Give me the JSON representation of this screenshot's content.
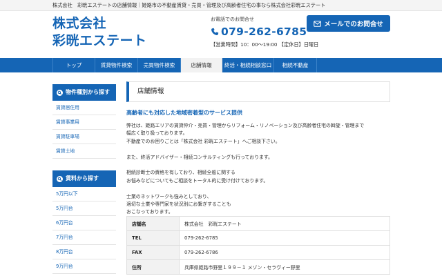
{
  "topbar": {
    "text": "株式会社　彩晄エステートの店舗情報｜姫路市の不動産賃貸・売買・管理及び高齢者住宅の事なら株式会社彩晄エステート"
  },
  "logo": {
    "line1": "株式会社",
    "line2": "彩晄エステート"
  },
  "contact": {
    "caption": "お電話でのお問合せ",
    "phone": "079-262-6785",
    "hours": "【営業時間】10：00〜19:00 【定休日】日曜日",
    "mail_button": "メールでのお問合せ"
  },
  "nav": [
    "トップ",
    "賃貸物件検索",
    "売買物件検索",
    "店舗情報",
    "終活・相続相談窓口",
    "相続不動産"
  ],
  "sidebar": {
    "types_heading": "物件種別から探す",
    "types": [
      "賃貸居住用",
      "賃貸事業用",
      "賃貸駐車場",
      "賃貸土地"
    ],
    "rent_heading": "賃料から探す",
    "rents": [
      "5万円以下",
      "5万円台",
      "6万円台",
      "7万円台",
      "8万円台",
      "9万円台"
    ]
  },
  "main": {
    "title": "店舗情報",
    "subheading": "高齢者にも対応した地域密着型のサービス提供",
    "paragraphs": [
      "弊社は、姫路エリアの賃貸仲介・売買・管理からリフォーム・リノベーション及び高齢者住宅の斡旋・管理まで",
      "幅広く取り扱っております。",
      "不動産でのお困りごとは「株式会社 彩晄エステート」へご相談下さい。",
      "",
      "また、終活アドバイザー・相続コンサルティングも行っております。",
      "",
      "相続診断士の資格を有しており、相続全般に関する",
      "お悩みなどについてもご相談をトータル的に受け付けております。",
      "",
      "士業のネットワークも強みとしており、",
      "適切な士業や専門家を状況別にお繋ぎすることも",
      "おこなっております。"
    ]
  },
  "store_info": [
    {
      "label": "店舗名",
      "value": "株式会社　彩晄エステート"
    },
    {
      "label": "TEL",
      "value": "079-262-6785"
    },
    {
      "label": "FAX",
      "value": "079-262-6786"
    },
    {
      "label": "住所",
      "value": "兵庫県姫路市野里１９９－１ メゾン・セラヴィー野里"
    }
  ],
  "colors": {
    "brand": "#1565b5",
    "nav_active_bg": "#f2f2f2",
    "link": "#1565b5"
  }
}
